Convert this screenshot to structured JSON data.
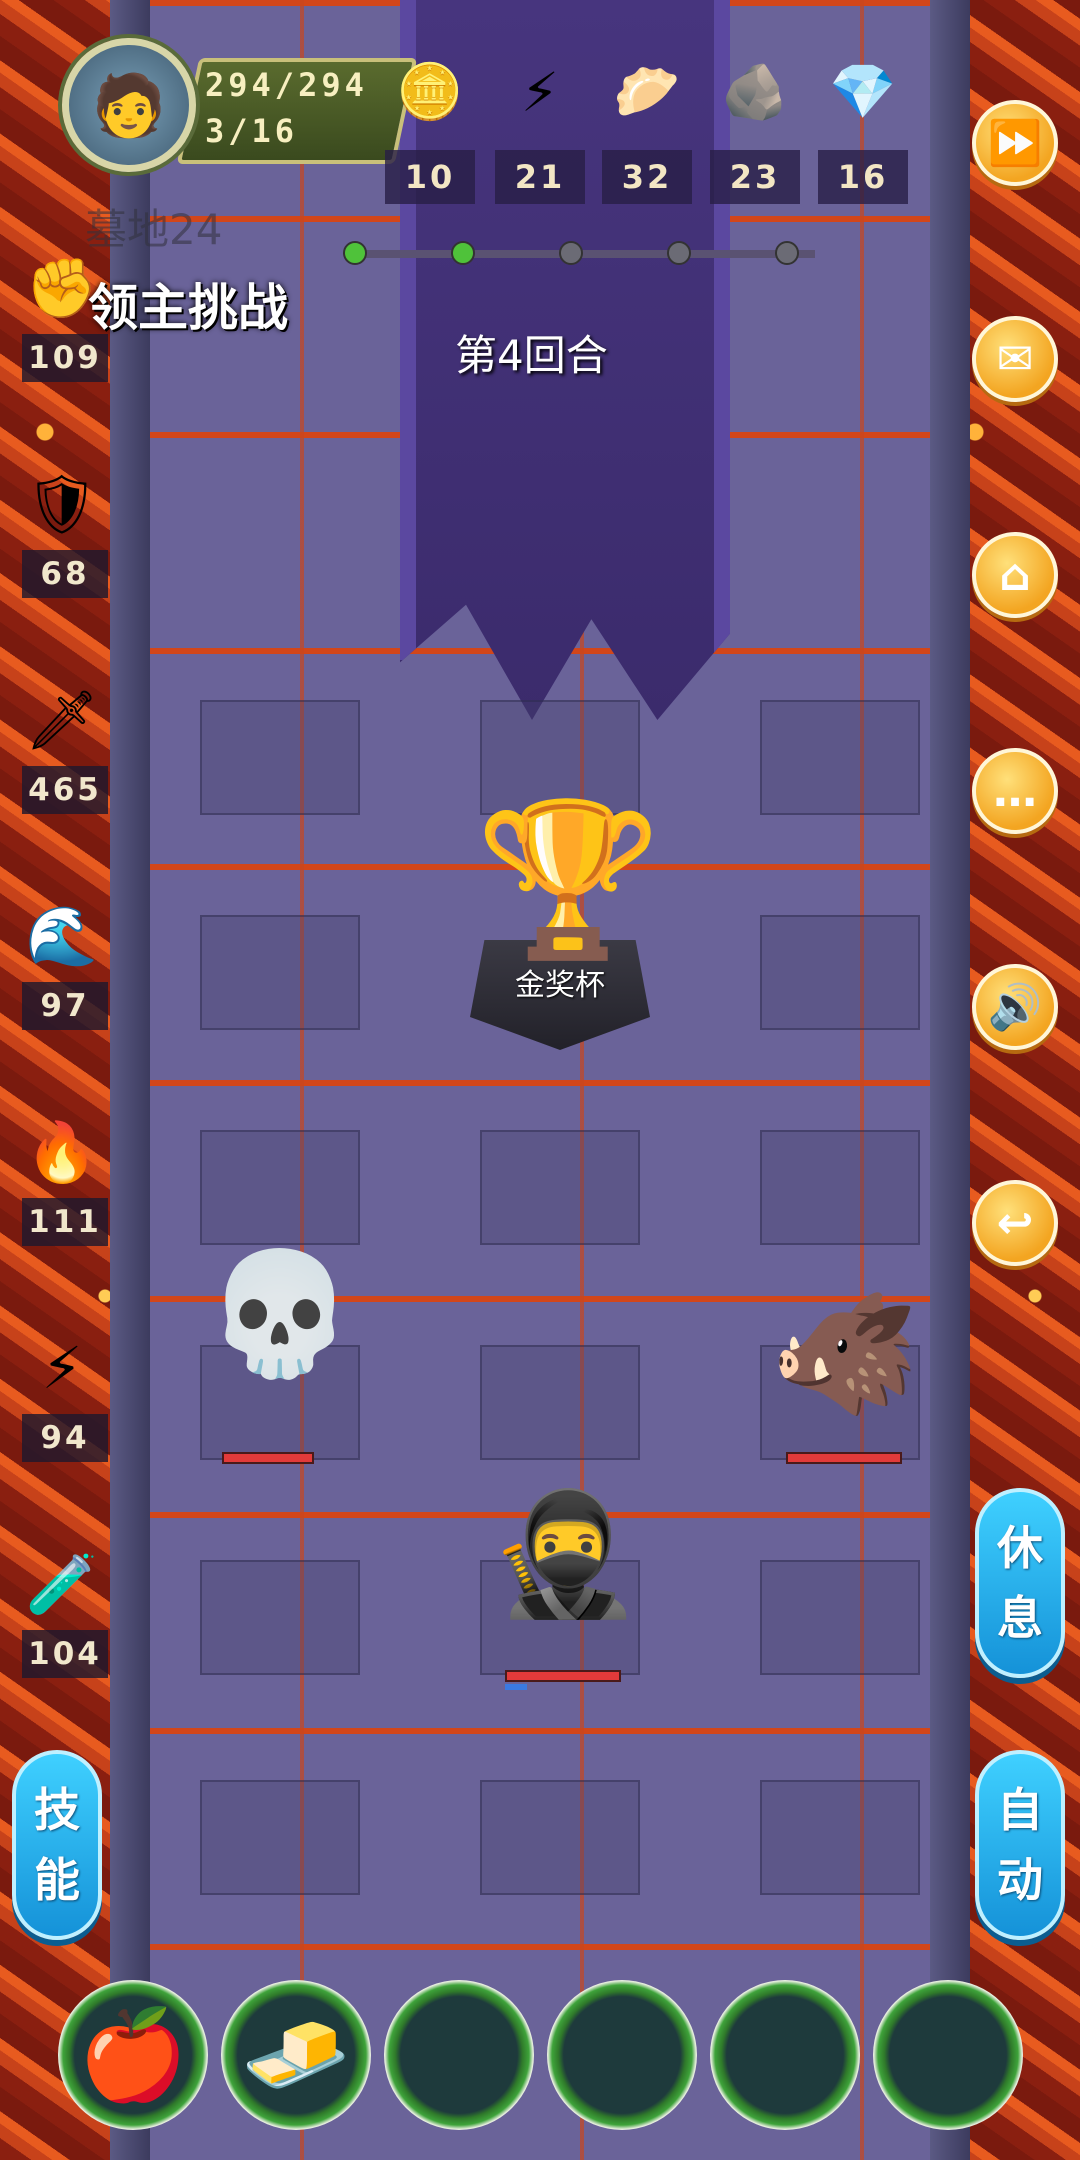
{
  "player": {
    "avatar_icon": "knight-portrait-icon",
    "hp": "294/294",
    "floor": "3/16"
  },
  "resources": [
    {
      "icon": "coin-icon",
      "glyph": "🪙",
      "value": "10"
    },
    {
      "icon": "lightning-icon",
      "glyph": "⚡",
      "value": "21"
    },
    {
      "icon": "bun-icon",
      "glyph": "🥟",
      "value": "32"
    },
    {
      "icon": "ore-icon",
      "glyph": "🪨",
      "value": "23"
    },
    {
      "icon": "crystal-icon",
      "glyph": "💎",
      "value": "16"
    }
  ],
  "faint_text": "墓地24",
  "challenge_title": "领主挑战",
  "round_text": "第4回合",
  "progress": {
    "total": 5,
    "completed": 2
  },
  "left_stats": [
    {
      "icon": "fist-icon",
      "glyph": "✊",
      "value": "109"
    },
    {
      "icon": "shield-icon",
      "glyph": "🛡",
      "value": "68"
    },
    {
      "icon": "sword-glow-icon",
      "glyph": "🗡",
      "value": "465"
    },
    {
      "icon": "water-wave-icon",
      "glyph": "🌊",
      "value": "97"
    },
    {
      "icon": "fire-icon",
      "glyph": "🔥",
      "value": "111"
    },
    {
      "icon": "lightning-purple-icon",
      "glyph": "⚡",
      "value": "94"
    },
    {
      "icon": "poison-icon",
      "glyph": "🧪",
      "value": "104"
    }
  ],
  "right_buttons": [
    {
      "name": "fast-forward-button",
      "icon": "fast-forward-icon",
      "glyph": "⏩"
    },
    {
      "name": "mail-button",
      "icon": "mail-icon",
      "glyph": "✉"
    },
    {
      "name": "home-button",
      "icon": "home-icon",
      "glyph": "⌂"
    },
    {
      "name": "chat-button",
      "icon": "chat-icon",
      "glyph": "…"
    },
    {
      "name": "sound-button",
      "icon": "speaker-icon",
      "glyph": "🔊"
    },
    {
      "name": "back-button",
      "icon": "back-arrow-icon",
      "glyph": "↩"
    }
  ],
  "trophy": {
    "icon": "gold-trophy-icon",
    "label": "金奖杯"
  },
  "enemies": [
    {
      "name": "skeleton-enemy",
      "icon": "skeleton-icon",
      "glyph": "💀"
    },
    {
      "name": "boar-enemy",
      "icon": "boar-icon",
      "glyph": "🐗"
    }
  ],
  "hero": {
    "icon": "hero-swordsman-icon",
    "glyph": "🥷"
  },
  "side_buttons": {
    "rest": [
      "休",
      "息"
    ],
    "skill": [
      "技",
      "能"
    ],
    "auto": [
      "自",
      "动"
    ]
  },
  "item_slots": [
    {
      "icon": "apple-icon",
      "glyph": "🍎"
    },
    {
      "icon": "gold-bar-icon",
      "glyph": "🧈"
    },
    {
      "icon": "empty-slot-icon",
      "glyph": ""
    },
    {
      "icon": "empty-slot-icon",
      "glyph": ""
    },
    {
      "icon": "empty-slot-icon",
      "glyph": ""
    },
    {
      "icon": "empty-slot-icon",
      "glyph": ""
    }
  ],
  "colors": {
    "button_orange": "#f3a521",
    "button_blue": "#1592d8",
    "lava": "#e85b1f",
    "hp_red": "#e23a3a"
  }
}
